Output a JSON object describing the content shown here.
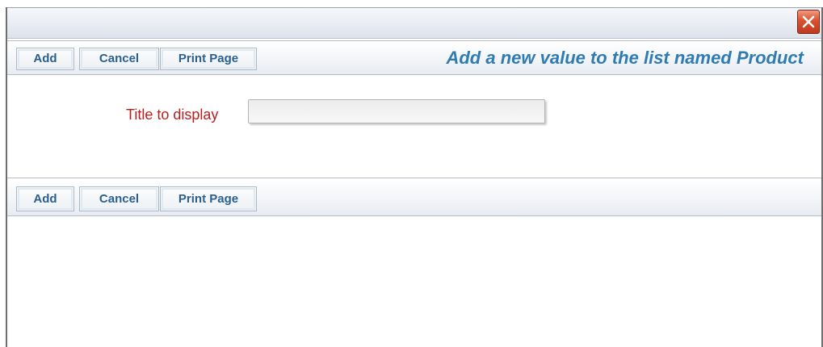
{
  "window": {
    "close_icon": "close-icon"
  },
  "toolbar_top": {
    "add_label": "Add",
    "cancel_label": "Cancel",
    "print_label": "Print Page"
  },
  "dialog": {
    "title": "Add a new value to the list named Product"
  },
  "form": {
    "title_label": "Title to display",
    "title_value": "",
    "title_placeholder": ""
  },
  "toolbar_bottom": {
    "add_label": "Add",
    "cancel_label": "Cancel",
    "print_label": "Print Page"
  },
  "colors": {
    "accent_title": "#2f7cb4",
    "button_text": "#2a5f8e",
    "label_text": "#b41f1f",
    "close_button": "#d9512f"
  }
}
